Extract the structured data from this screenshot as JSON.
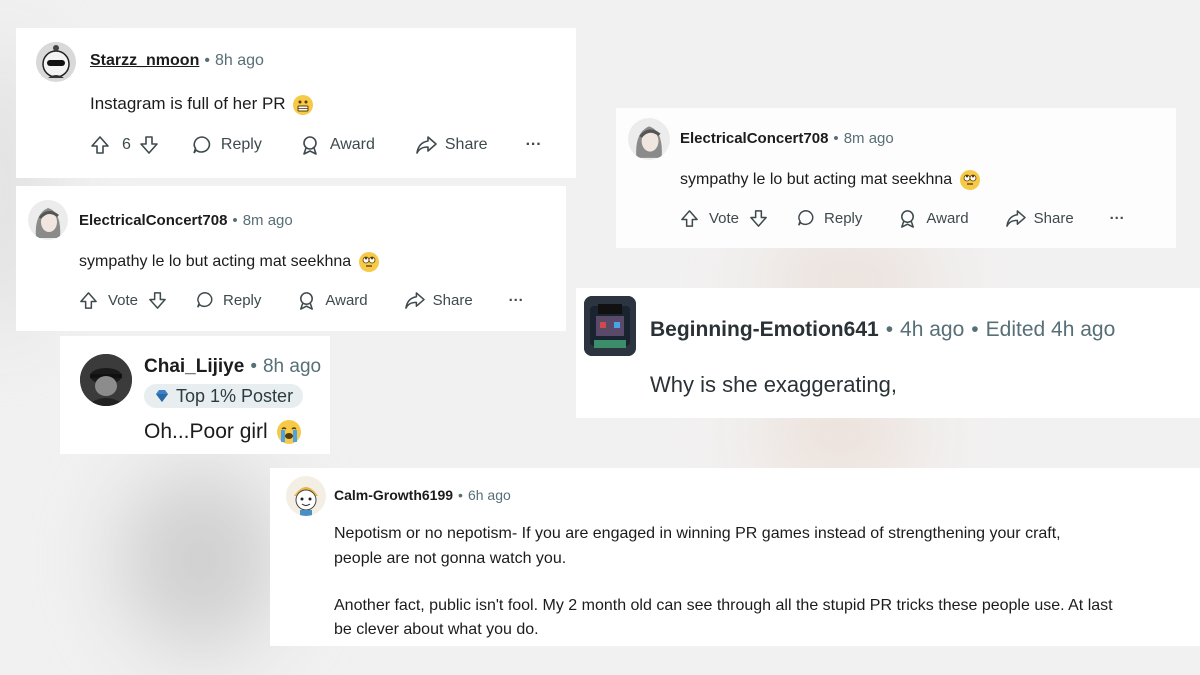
{
  "comments": [
    {
      "username": "Starzz_nmoon",
      "time": "8h ago",
      "body": "Instagram is full of her PR",
      "votes": "6",
      "reply": "Reply",
      "award": "Award",
      "share": "Share",
      "more": "···"
    },
    {
      "username": "ElectricalConcert708",
      "time": "8m ago",
      "body": "sympathy le lo but acting mat seekhna",
      "votes": "Vote",
      "reply": "Reply",
      "award": "Award",
      "share": "Share",
      "more": "···"
    },
    {
      "username": "ElectricalConcert708",
      "time": "8m ago",
      "body": "sympathy le lo but acting mat seekhna",
      "votes": "Vote",
      "reply": "Reply",
      "award": "Award",
      "share": "Share",
      "more": "···"
    },
    {
      "username": "Chai_Lijiye",
      "time": "8h ago",
      "badge": "Top 1% Poster",
      "body": "Oh...Poor girl"
    },
    {
      "username": "Beginning-Emotion641",
      "time": "4h ago",
      "edited": "Edited 4h ago",
      "body": "Why is she exaggerating,"
    },
    {
      "username": "Calm-Growth6199",
      "time": "6h ago",
      "para1_line1": "Nepotism or no nepotism- If you are engaged in winning PR games instead of strengthening your craft,",
      "para1_line2": "people are not gonna watch you.",
      "para2_line1": "Another fact, public isn't fool. My 2 month old can see through all the stupid PR tricks these people use. At last",
      "para2_line2": "be clever about what you do."
    }
  ],
  "separator": "•",
  "colors": {
    "meta": "#576f76",
    "text": "#1c1c1c",
    "badge_bg": "#e8edf0"
  }
}
